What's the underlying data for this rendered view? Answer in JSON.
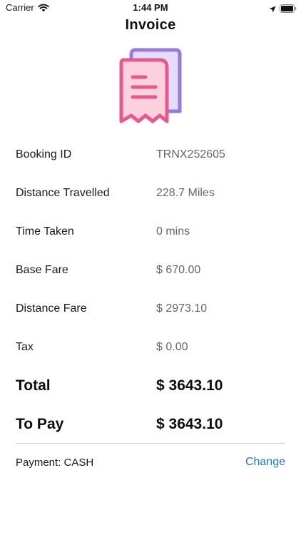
{
  "status_bar": {
    "carrier": "Carrier",
    "time": "1:44 PM",
    "icons": [
      "wifi-icon",
      "location-arrow-icon",
      "battery-icon"
    ]
  },
  "header": {
    "title": "Invoice"
  },
  "illustration": {
    "icon": "receipt-icon",
    "colors": {
      "front_fill": "#fbd1de",
      "front_stroke": "#e8588b",
      "back_fill": "#e3dcfb",
      "back_stroke": "#9a7ad6"
    }
  },
  "invoice": {
    "booking_id": {
      "label": "Booking ID",
      "value": "TRNX252605"
    },
    "distance_travelled": {
      "label": "Distance Travelled",
      "value": "228.7 Miles"
    },
    "time_taken": {
      "label": "Time Taken",
      "value": "0 mins"
    },
    "base_fare": {
      "label": "Base Fare",
      "value": "$ 670.00"
    },
    "distance_fare": {
      "label": "Distance Fare",
      "value": "$ 2973.10"
    },
    "tax": {
      "label": "Tax",
      "value": "$ 0.00"
    },
    "total": {
      "label": "Total",
      "value": "$ 3643.10"
    },
    "to_pay": {
      "label": "To Pay",
      "value": "$ 3643.10"
    }
  },
  "payment": {
    "text": "Payment: CASH",
    "change_label": "Change",
    "accent_color": "#1a7ad6"
  }
}
